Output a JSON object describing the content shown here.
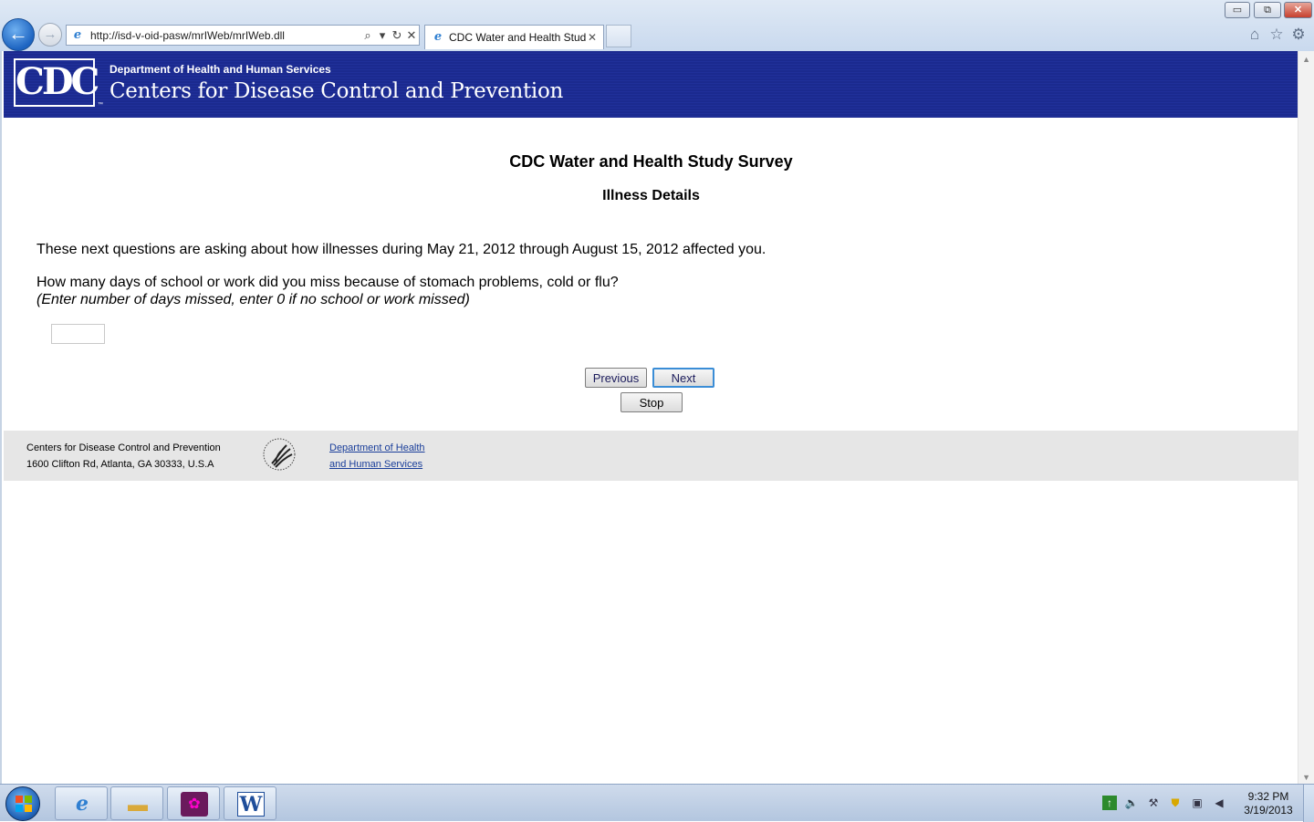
{
  "browser": {
    "address_url": "http://isd-v-oid-pasw/mrIWeb/mrIWeb.dll",
    "tab_title": "CDC Water and Health Study",
    "window_controls": {
      "minimize": "▭",
      "maximize": "⧉",
      "close": "✕"
    }
  },
  "header": {
    "logo_text": "CDC",
    "trademark": "™",
    "department": "Department of Health and Human Services",
    "agency": "Centers for Disease Control and Prevention"
  },
  "survey": {
    "title": "CDC Water and Health Study Survey",
    "section": "Illness Details",
    "intro": "These next questions are asking about how illnesses during May 21, 2012 through August 15, 2012 affected you.",
    "question": "How many days of school or work did you miss because of stomach problems, cold or flu?",
    "hint": "(Enter number of days missed, enter 0 if no school or work missed)",
    "answer_value": ""
  },
  "buttons": {
    "previous": "Previous",
    "next": "Next",
    "stop": "Stop"
  },
  "footer": {
    "org": "Centers for Disease Control and Prevention",
    "address": "1600 Clifton Rd, Atlanta, GA 30333, U.S.A",
    "hhs_link_line1": "Department of Health",
    "hhs_link_line2": "and Human Services"
  },
  "taskbar": {
    "time": "9:32 PM",
    "date": "3/19/2013",
    "pinned": [
      "internet-explorer",
      "windows-explorer",
      "media-app",
      "microsoft-word"
    ]
  },
  "colors": {
    "cdc_blue": "#1b2a8f",
    "footer_bg": "#e6e6e6",
    "link": "#1a3e9a"
  }
}
